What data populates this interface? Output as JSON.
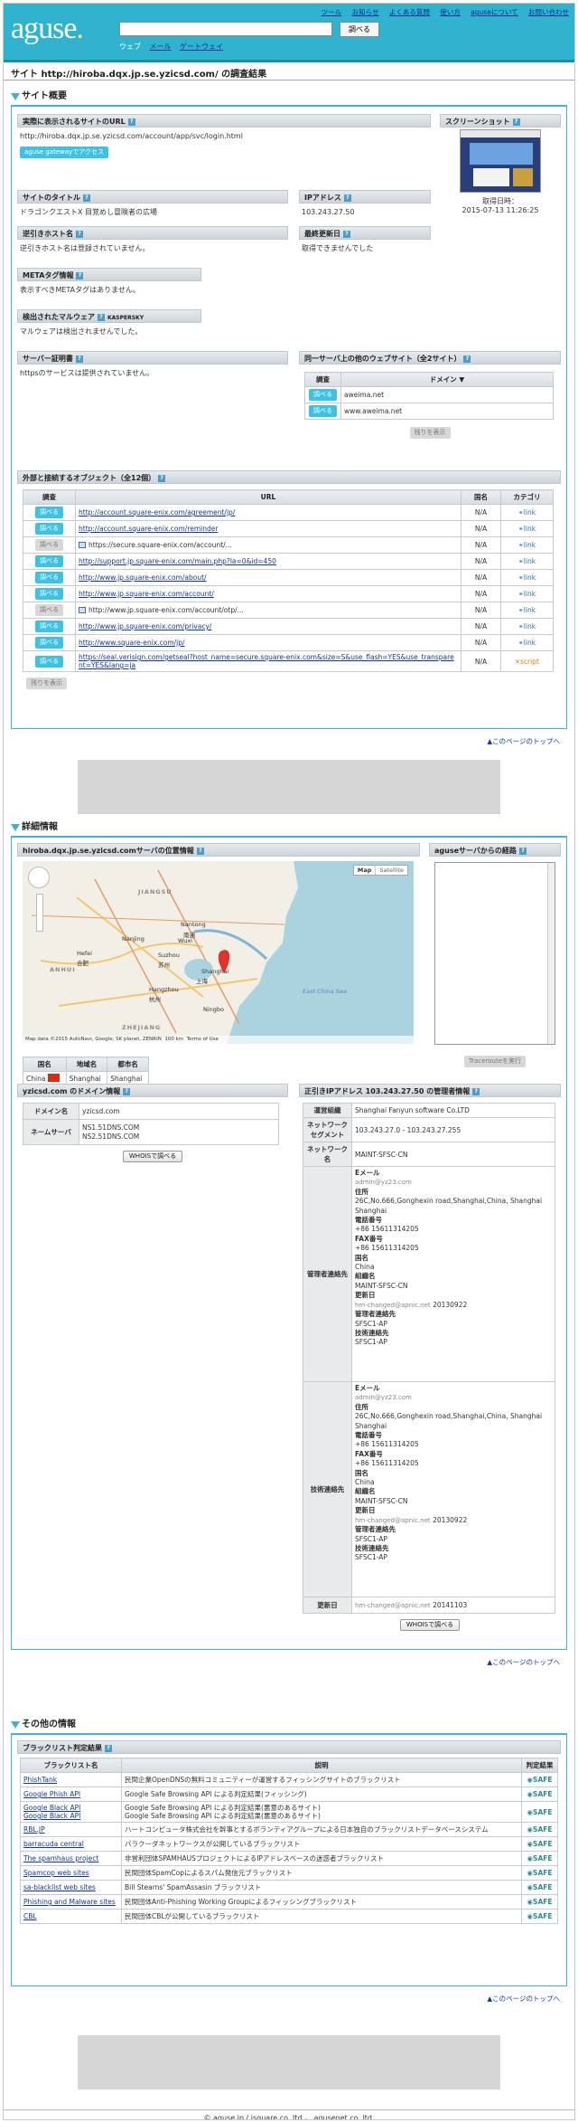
{
  "header": {
    "logo": "aguse",
    "logo_dot": ".",
    "search_button": "調べる",
    "subnav": [
      "ウェブ",
      "メール",
      "ゲートウェイ"
    ],
    "topnav": [
      "ツール",
      "お知らせ",
      "よくある質問",
      "使い方",
      "aguseについて",
      "お問い合わせ"
    ]
  },
  "page_title": "サイト http://hiroba.dqx.jp.se.yzicsd.com/ の調査結果",
  "overview": {
    "heading": "サイト概要",
    "url_label": "実際に表示されるサイトのURL",
    "url_value": "http://hiroba.dqx.jp.se.yzicsd.com/account/app/svc/login.html",
    "gateway_button": "aguse gatewayでアクセス",
    "screenshot_label": "スクリーンショット",
    "fetch_time_label": "取得日時：",
    "fetch_time": "2015-07-13 11:26:25",
    "site_title_label": "サイトのタイトル",
    "site_title": "ドラゴンクエストX 目覚めし冒険者の広場",
    "ip_label": "IPアドレス",
    "ip_value": "103.243.27.50",
    "reverse_host_label": "逆引きホスト名",
    "reverse_host_value": "逆引きホスト名は登録されていません。",
    "last_modified_label": "最終更新日",
    "last_modified_value": "取得できませんでした",
    "meta_label": "METAタグ情報",
    "meta_value": "表示すべきMETAタグはありません。",
    "malware_label": "検出されたマルウェア",
    "malware_brand": "KASPERSKY",
    "malware_value": "マルウェアは検出されませんでした。",
    "cert_label": "サーバー証明書",
    "cert_value": "httpsのサービスは提供されていません。",
    "same_server_label": "同一サーバ上の他のウェブサイト（全2サイト）",
    "same_server_head": [
      "調査",
      "ドメイン ▼"
    ],
    "same_server_rows": [
      "aweima.net",
      "www.aweima.net"
    ],
    "check_button": "調べる",
    "more_button": "残りを表示",
    "objects_label": "外部と接続するオブジェクト（全12個）",
    "objects_head": [
      "調査",
      "URL",
      "国名",
      "カテゴリ"
    ],
    "objects": [
      {
        "btn": "調べる",
        "url": "http://account.square-enix.com/agreement/jp/",
        "country": "N/A",
        "cat": "link",
        "enabled": true,
        "img": false
      },
      {
        "btn": "調べる",
        "url": "http://account.square-enix.com/reminder",
        "country": "N/A",
        "cat": "link",
        "enabled": true,
        "img": false
      },
      {
        "btn": "調べる",
        "url": "https://secure.square-enix.com/account/...",
        "country": "N/A",
        "cat": "link",
        "enabled": false,
        "img": true
      },
      {
        "btn": "調べる",
        "url": "http://support.jp.square-enix.com/main.php?la=0&id=450",
        "country": "N/A",
        "cat": "link",
        "enabled": true,
        "img": false
      },
      {
        "btn": "調べる",
        "url": "http://www.jp.square-enix.com/about/",
        "country": "N/A",
        "cat": "link",
        "enabled": true,
        "img": false
      },
      {
        "btn": "調べる",
        "url": "http://www.jp.square-enix.com/account/",
        "country": "N/A",
        "cat": "link",
        "enabled": true,
        "img": false
      },
      {
        "btn": "調べる",
        "url": "http://www.jp.square-enix.com/account/otp/...",
        "country": "N/A",
        "cat": "link",
        "enabled": false,
        "img": true
      },
      {
        "btn": "調べる",
        "url": "http://www.jp.square-enix.com/privacy/",
        "country": "N/A",
        "cat": "link",
        "enabled": true,
        "img": false
      },
      {
        "btn": "調べる",
        "url": "http://www.square-enix.com/jp/",
        "country": "N/A",
        "cat": "link",
        "enabled": true,
        "img": false
      },
      {
        "btn": "調べる",
        "url": "https://seal.verisign.com/getseal?host_name=secure.square-enix.com&size=S&use_flash=YES&use_transparent=YES&lang=ja",
        "country": "N/A",
        "cat": "script",
        "enabled": true,
        "img": false
      }
    ],
    "to_top": "▲このページのトップへ"
  },
  "details": {
    "heading": "詳細情報",
    "location_label": "hiroba.dqx.jp.se.yzicsd.comサーバの位置情報",
    "route_label": "aguseサーバからの経路",
    "map_buttons": [
      "Map",
      "Satellite"
    ],
    "map_places": [
      {
        "name": "JIANGSU",
        "cls": "region"
      },
      {
        "name": "ANHUI",
        "cls": "region"
      },
      {
        "name": "ZHEJIANG",
        "cls": "region"
      },
      {
        "name": "Nantong",
        "cls": "city"
      },
      {
        "name": "南通",
        "cls": "city"
      },
      {
        "name": "Suzhou",
        "cls": "city"
      },
      {
        "name": "苏州",
        "cls": "city"
      },
      {
        "name": "Shanghai",
        "cls": "city"
      },
      {
        "name": "上海",
        "cls": "city"
      },
      {
        "name": "Wuxi",
        "cls": "city"
      },
      {
        "name": "Hefei",
        "cls": "city"
      },
      {
        "name": "合肥",
        "cls": "city"
      },
      {
        "name": "Nanjing",
        "cls": "city"
      },
      {
        "name": "Hangzhou",
        "cls": "city"
      },
      {
        "name": "杭州",
        "cls": "city"
      },
      {
        "name": "Ningbo",
        "cls": "city"
      },
      {
        "name": "East China Sea",
        "cls": "sea"
      }
    ],
    "map_footer": "Map data ©2015 AutoNavi, Google, SK planet, ZENRIN",
    "map_scale": "100 km",
    "map_terms": "Terms of Use",
    "geo_head": [
      "国名",
      "地域名",
      "都市名"
    ],
    "geo_row": [
      "China",
      "Shanghai",
      "Shanghai"
    ],
    "traceroute_button": "Tracerouteを実行",
    "domain_label": "yzicsd.com のドメイン情報",
    "domain_rows": [
      {
        "k": "ドメイン名",
        "v": "yzicsd.com"
      },
      {
        "k": "ネームサーバ",
        "v": "NS1.51DNS.COM\nNS2.51DNS.COM"
      }
    ],
    "whois_button": "WHOISで調べる",
    "ip_admin_label": "正引きIPアドレス 103.243.27.50 の管理者情報",
    "ip_rows": [
      {
        "k": "運営組織",
        "v": "Shanghai Fanyun software Co.LTD"
      },
      {
        "k": "ネットワークセグメント",
        "v": "103.243.27.0 - 103.243.27.255"
      },
      {
        "k": "ネットワーク名",
        "v": "MAINT-SFSC-CN"
      }
    ],
    "admin_contact_label": "管理者連絡先",
    "tech_contact_label": "技術連絡先",
    "contact": {
      "email_label": "Eメール",
      "email": "admin@yz23.com",
      "addr_label": "住所",
      "addr": "26C,No.666,Gonghexin road,Shanghai,China, Shanghai Shanghai",
      "tel_label": "電話番号",
      "tel": "+86 15611314205",
      "fax_label": "FAX番号",
      "fax": "+86 15611314205",
      "country_label": "国名",
      "country": "China",
      "org_label": "組織名",
      "org": "MAINT-SFSC-CN",
      "updated_label": "更新日",
      "updated_by": "hm-changed@apnic.net",
      "updated": "20130922",
      "mgr_label": "管理者連絡先",
      "mgr": "SFSC1-AP",
      "tech_label": "技術連絡先",
      "tech": "SFSC1-AP"
    },
    "update_label": "更新日",
    "update_by": "hm-changed@apnic.net",
    "update_value": "20141103",
    "whois_button2": "WHOISで調べる",
    "to_top": "▲このページのトップへ"
  },
  "other": {
    "heading": "その他の情報",
    "bl_label": "ブラックリスト判定結果",
    "bl_head": [
      "ブラックリスト名",
      "説明",
      "判定結果"
    ],
    "bl_rows": [
      {
        "name": "PhishTank",
        "desc": "民間企業OpenDNSの無料コミュニティーが運営するフィッシングサイトのブラックリスト",
        "res": "SAFE"
      },
      {
        "name": "Google Phish API",
        "desc": "Google Safe Browsing API による判定結果(フィッシング)",
        "res": "SAFE"
      },
      {
        "name": "Google Black API\nGoogle Black API",
        "desc": "Google Safe Browsing API による判定結果(悪意のあるサイト)\nGoogle Safe Browsing API による判定結果(悪意のあるサイト)",
        "res": "SAFE"
      },
      {
        "name": "RBL.JP",
        "desc": "ハートコンピュータ株式会社を幹事とするボランティアグループによる日本独自のブラックリストデータベースシステム",
        "res": "SAFE"
      },
      {
        "name": "barracuda central",
        "desc": "バラクーダネットワークスが公開しているブラックリスト",
        "res": "SAFE"
      },
      {
        "name": "The spamhaus project",
        "desc": "非営利団体SPAMHAUSプロジェクトによるIPアドレスベースの迷惑者ブラックリスト",
        "res": "SAFE"
      },
      {
        "name": "Spamcop web sites",
        "desc": "民間団体SpamCopによるスパム発信元ブラックリスト",
        "res": "SAFE"
      },
      {
        "name": "sa-blacklist web sites",
        "desc": "Bill Stearns' SpamAssasin ブラックリスト",
        "res": "SAFE"
      },
      {
        "name": "Phishing and Malware sites",
        "desc": "民間団体Anti-Phishing Working Groupによるフィッシングブラックリスト",
        "res": "SAFE"
      },
      {
        "name": "CBL",
        "desc": "民間団体CBLが公開しているブラックリスト",
        "res": "SAFE"
      }
    ],
    "to_top": "▲このページのトップへ"
  },
  "footer": "© aguse.jp / isquare co.,ltd.， agusenet co.,ltd."
}
